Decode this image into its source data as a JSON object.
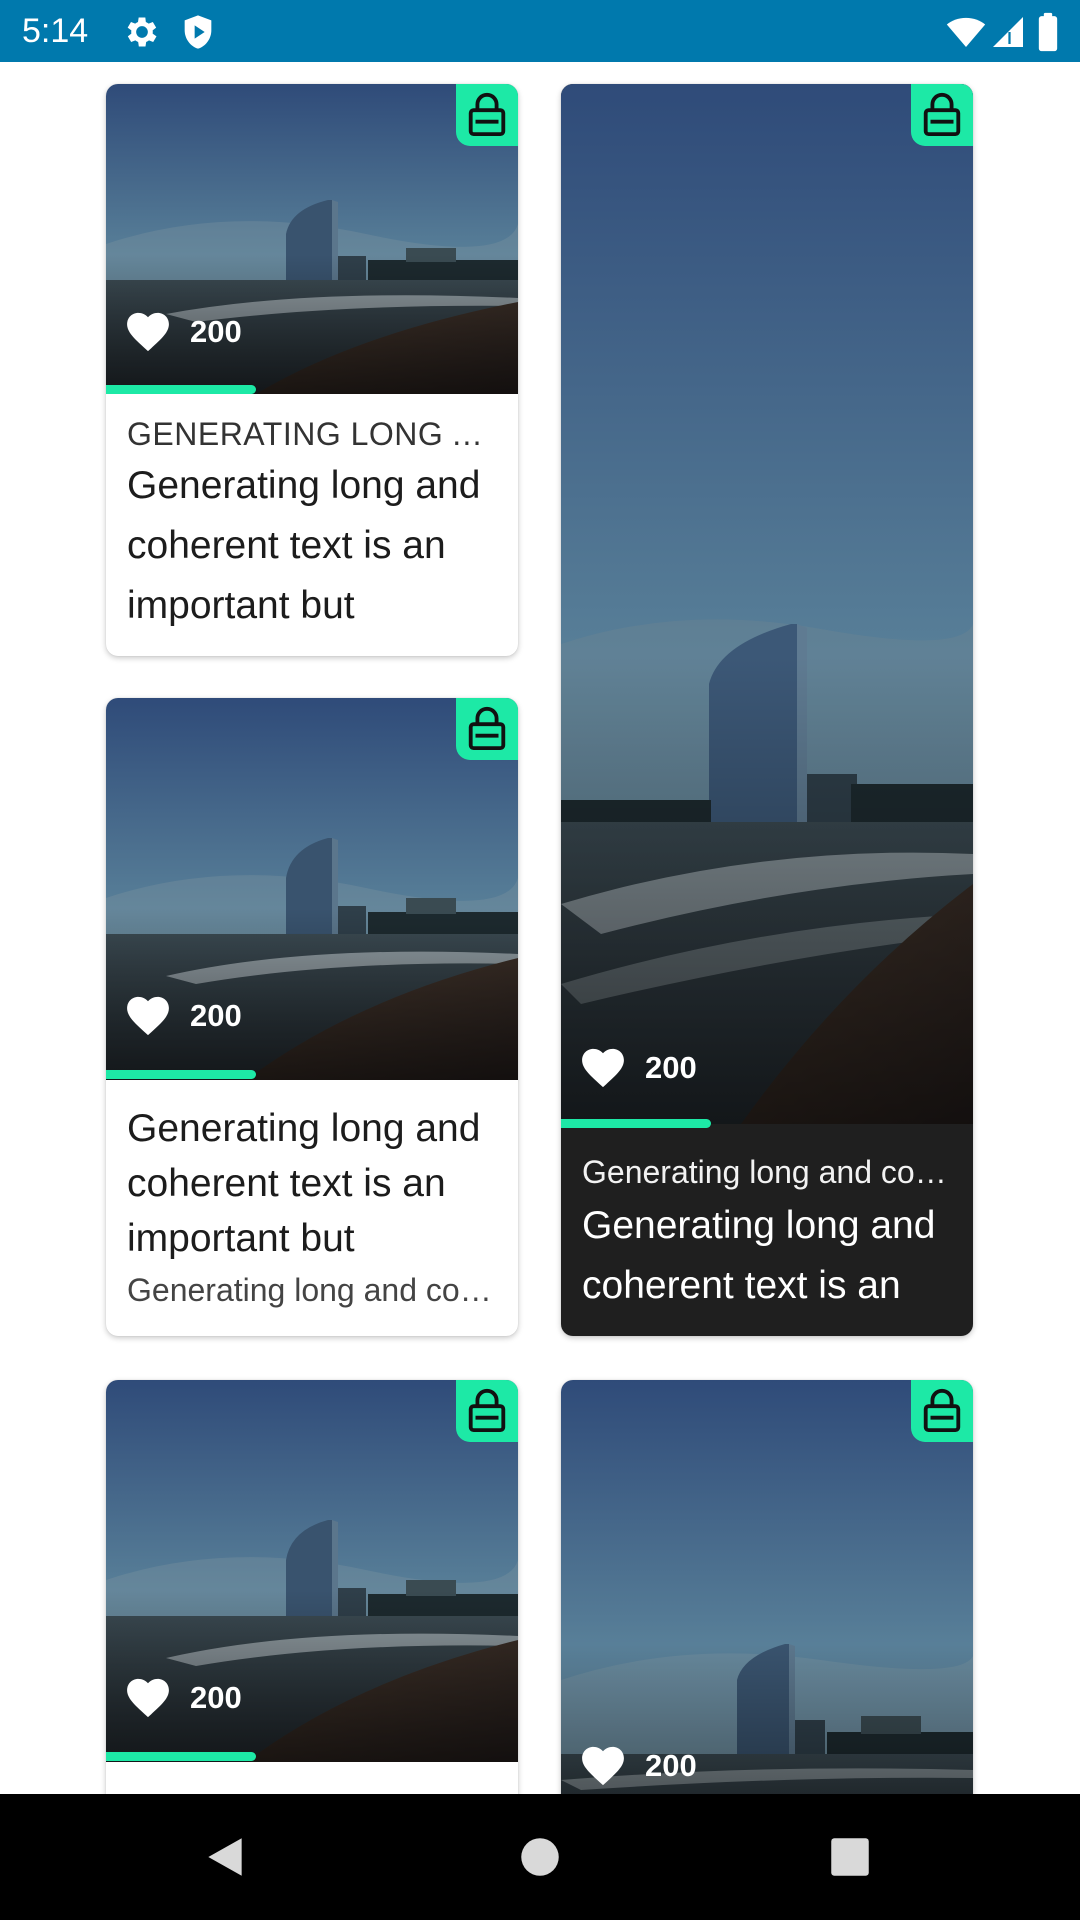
{
  "status_bar": {
    "time": "5:14",
    "icons": [
      "gear-icon",
      "shield-play-icon",
      "wifi-icon",
      "signal-icon",
      "battery-icon"
    ],
    "background_color": "#0079AD"
  },
  "accent_color": "#1DE9A6",
  "cards": [
    {
      "id": "card-1",
      "locked": true,
      "likes": "200",
      "progress_percent": 36,
      "overline": "GENERATING LONG AND COHERENT TEXT IS AN IMPORTANT BUT CHALLENGING TASK",
      "title": "Generating long and coherent text is an important but challenging task"
    },
    {
      "id": "card-2",
      "locked": true,
      "likes": "200",
      "progress_percent": 36,
      "title": "Generating long and coherent text is an important but challenging task",
      "subtitle": "Generating long and coherent text is an important but challenging task"
    },
    {
      "id": "card-3",
      "locked": true,
      "likes": "200",
      "progress_percent": 36,
      "subtitle": "Generating long and coherent text is an important but challenging task",
      "title": "Generating long and coherent text is an important but challenging task"
    },
    {
      "id": "card-4",
      "locked": true,
      "likes": "200",
      "progress_percent": 36
    },
    {
      "id": "card-5",
      "locked": true,
      "likes": "200"
    }
  ],
  "nav_bar": {
    "buttons": [
      "back-icon",
      "home-icon",
      "recents-icon"
    ]
  }
}
